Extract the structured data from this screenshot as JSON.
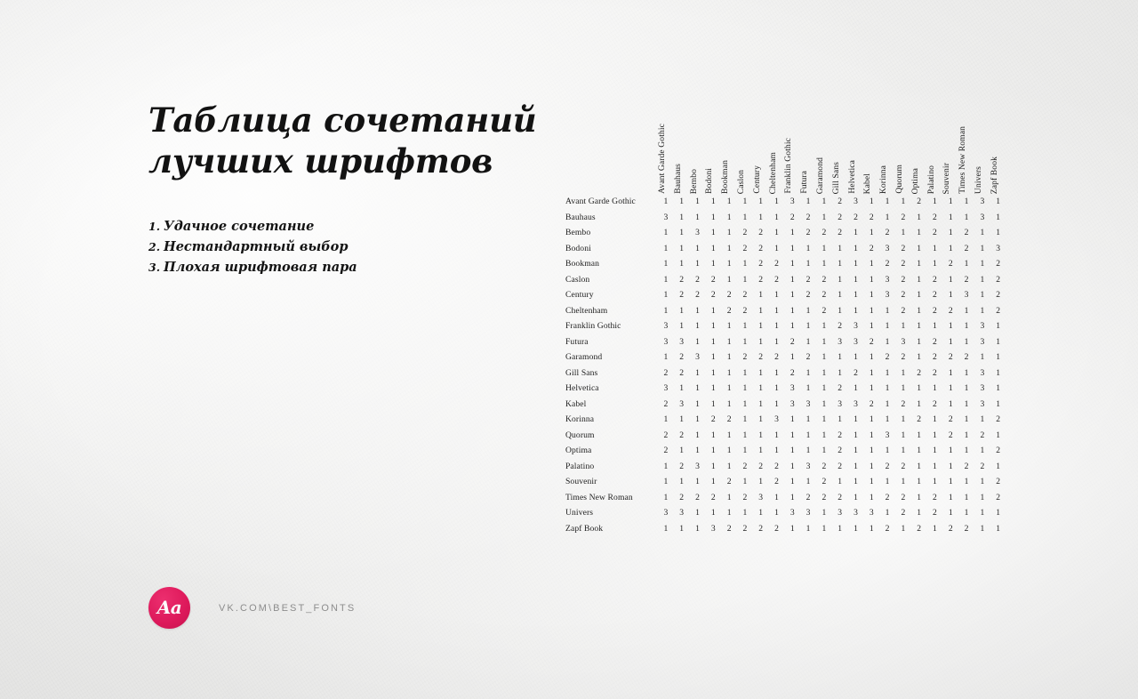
{
  "page": {
    "background_color": "#f2f2f1",
    "title": "Таблица сочетаний\nлучших шрифтов"
  },
  "legend": {
    "items": [
      {
        "index": "1.",
        "label": "Удачное сочетание"
      },
      {
        "index": "2.",
        "label": "Нестандартный выбор"
      },
      {
        "index": "3.",
        "label": "Плохая шрифтовая пара"
      }
    ]
  },
  "footer": {
    "logo_text": "Aa",
    "logo_color": "#e0195c",
    "url": "vk.com\\best_fonts"
  },
  "chart_data": {
    "type": "heatmap",
    "title": "Таблица сочетаний лучших шрифтов",
    "xlabel": "",
    "ylabel": "",
    "grid": false,
    "legend_position": "left",
    "value_scale": [
      1,
      2,
      3
    ],
    "value_meanings": {
      "1": "Удачное сочетание",
      "2": "Нестандартный выбор",
      "3": "Плохая шрифтовая пара"
    },
    "categories": [
      "Avant Garde Gothic",
      "Bauhaus",
      "Bembo",
      "Bodoni",
      "Bookman",
      "Caslon",
      "Century",
      "Cheltenham",
      "Franklin Gothic",
      "Futura",
      "Garamond",
      "Gill Sans",
      "Helvetica",
      "Kabel",
      "Korinna",
      "Quorum",
      "Optima",
      "Palatino",
      "Souvenir",
      "Times New Roman",
      "Univers",
      "Zapf Book"
    ],
    "columns": [
      "Avant Garde Gothic",
      "Bauhaus",
      "Bembo",
      "Bodoni",
      "Bookman",
      "Caslon",
      "Century",
      "Cheltenham",
      "Franklin Gothic",
      "Futura",
      "Garamond",
      "Gill Sans",
      "Helvetica",
      "Kabel",
      "Korinna",
      "Quorum",
      "Optima",
      "Palatino",
      "Souvenir",
      "Times New Roman",
      "Univers",
      "Zapf Book"
    ],
    "rows": [
      "Avant Garde Gothic",
      "Bauhaus",
      "Bembo",
      "Bodoni",
      "Bookman",
      "Caslon",
      "Century",
      "Cheltenham",
      "Franklin Gothic",
      "Futura",
      "Garamond",
      "Gill Sans",
      "Helvetica",
      "Kabel",
      "Korinna",
      "Quorum",
      "Optima",
      "Palatino",
      "Souvenir",
      "Times New Roman",
      "Univers",
      "Zapf Book"
    ],
    "values": [
      [
        1,
        1,
        1,
        1,
        1,
        1,
        1,
        1,
        3,
        1,
        1,
        2,
        3,
        1,
        1,
        1,
        2,
        1,
        1,
        1,
        3,
        1
      ],
      [
        3,
        1,
        1,
        1,
        1,
        1,
        1,
        1,
        2,
        2,
        1,
        2,
        2,
        2,
        1,
        2,
        1,
        2,
        1,
        1,
        3,
        1
      ],
      [
        1,
        1,
        3,
        1,
        1,
        2,
        2,
        1,
        1,
        2,
        2,
        2,
        1,
        1,
        2,
        1,
        1,
        2,
        1,
        2,
        1,
        1
      ],
      [
        1,
        1,
        1,
        1,
        1,
        2,
        2,
        1,
        1,
        1,
        1,
        1,
        1,
        2,
        3,
        2,
        1,
        1,
        1,
        2,
        1,
        3
      ],
      [
        1,
        1,
        1,
        1,
        1,
        1,
        2,
        2,
        1,
        1,
        1,
        1,
        1,
        1,
        2,
        2,
        1,
        1,
        2,
        1,
        1,
        2
      ],
      [
        1,
        2,
        2,
        2,
        1,
        1,
        2,
        2,
        1,
        2,
        2,
        1,
        1,
        1,
        3,
        2,
        1,
        2,
        1,
        2,
        1,
        2
      ],
      [
        1,
        2,
        2,
        2,
        2,
        2,
        1,
        1,
        1,
        2,
        2,
        1,
        1,
        1,
        3,
        2,
        1,
        2,
        1,
        3,
        1,
        2
      ],
      [
        1,
        1,
        1,
        1,
        2,
        2,
        1,
        1,
        1,
        1,
        2,
        1,
        1,
        1,
        1,
        2,
        1,
        2,
        2,
        1,
        1,
        2
      ],
      [
        3,
        1,
        1,
        1,
        1,
        1,
        1,
        1,
        1,
        1,
        1,
        2,
        3,
        1,
        1,
        1,
        1,
        1,
        1,
        1,
        3,
        1
      ],
      [
        3,
        3,
        1,
        1,
        1,
        1,
        1,
        1,
        2,
        1,
        1,
        3,
        3,
        2,
        1,
        3,
        1,
        2,
        1,
        1,
        3,
        1
      ],
      [
        1,
        2,
        3,
        1,
        1,
        2,
        2,
        2,
        1,
        2,
        1,
        1,
        1,
        1,
        2,
        2,
        1,
        2,
        2,
        2,
        1,
        1
      ],
      [
        2,
        2,
        1,
        1,
        1,
        1,
        1,
        1,
        2,
        1,
        1,
        1,
        2,
        1,
        1,
        1,
        2,
        2,
        1,
        1,
        3,
        1
      ],
      [
        3,
        1,
        1,
        1,
        1,
        1,
        1,
        1,
        3,
        1,
        1,
        2,
        1,
        1,
        1,
        1,
        1,
        1,
        1,
        1,
        3,
        1
      ],
      [
        2,
        3,
        1,
        1,
        1,
        1,
        1,
        1,
        3,
        3,
        1,
        3,
        3,
        2,
        1,
        2,
        1,
        2,
        1,
        1,
        3,
        1
      ],
      [
        1,
        1,
        1,
        2,
        2,
        1,
        1,
        3,
        1,
        1,
        1,
        1,
        1,
        1,
        1,
        1,
        2,
        1,
        2,
        1,
        1,
        2
      ],
      [
        2,
        2,
        1,
        1,
        1,
        1,
        1,
        1,
        1,
        1,
        1,
        2,
        1,
        1,
        3,
        1,
        1,
        1,
        2,
        1,
        2,
        1
      ],
      [
        2,
        1,
        1,
        1,
        1,
        1,
        1,
        1,
        1,
        1,
        1,
        2,
        1,
        1,
        1,
        1,
        1,
        1,
        1,
        1,
        1,
        2
      ],
      [
        1,
        2,
        3,
        1,
        1,
        2,
        2,
        2,
        1,
        3,
        2,
        2,
        1,
        1,
        2,
        2,
        1,
        1,
        1,
        2,
        2,
        1
      ],
      [
        1,
        1,
        1,
        1,
        2,
        1,
        1,
        2,
        1,
        1,
        2,
        1,
        1,
        1,
        1,
        1,
        1,
        1,
        1,
        1,
        1,
        2
      ],
      [
        1,
        2,
        2,
        2,
        1,
        2,
        3,
        1,
        1,
        2,
        2,
        2,
        1,
        1,
        2,
        2,
        1,
        2,
        1,
        1,
        1,
        2
      ],
      [
        3,
        3,
        1,
        1,
        1,
        1,
        1,
        1,
        3,
        3,
        1,
        3,
        3,
        3,
        1,
        2,
        1,
        2,
        1,
        1,
        1,
        1
      ],
      [
        1,
        1,
        1,
        3,
        2,
        2,
        2,
        2,
        1,
        1,
        1,
        1,
        1,
        1,
        2,
        1,
        2,
        1,
        2,
        2,
        1,
        1
      ]
    ]
  }
}
